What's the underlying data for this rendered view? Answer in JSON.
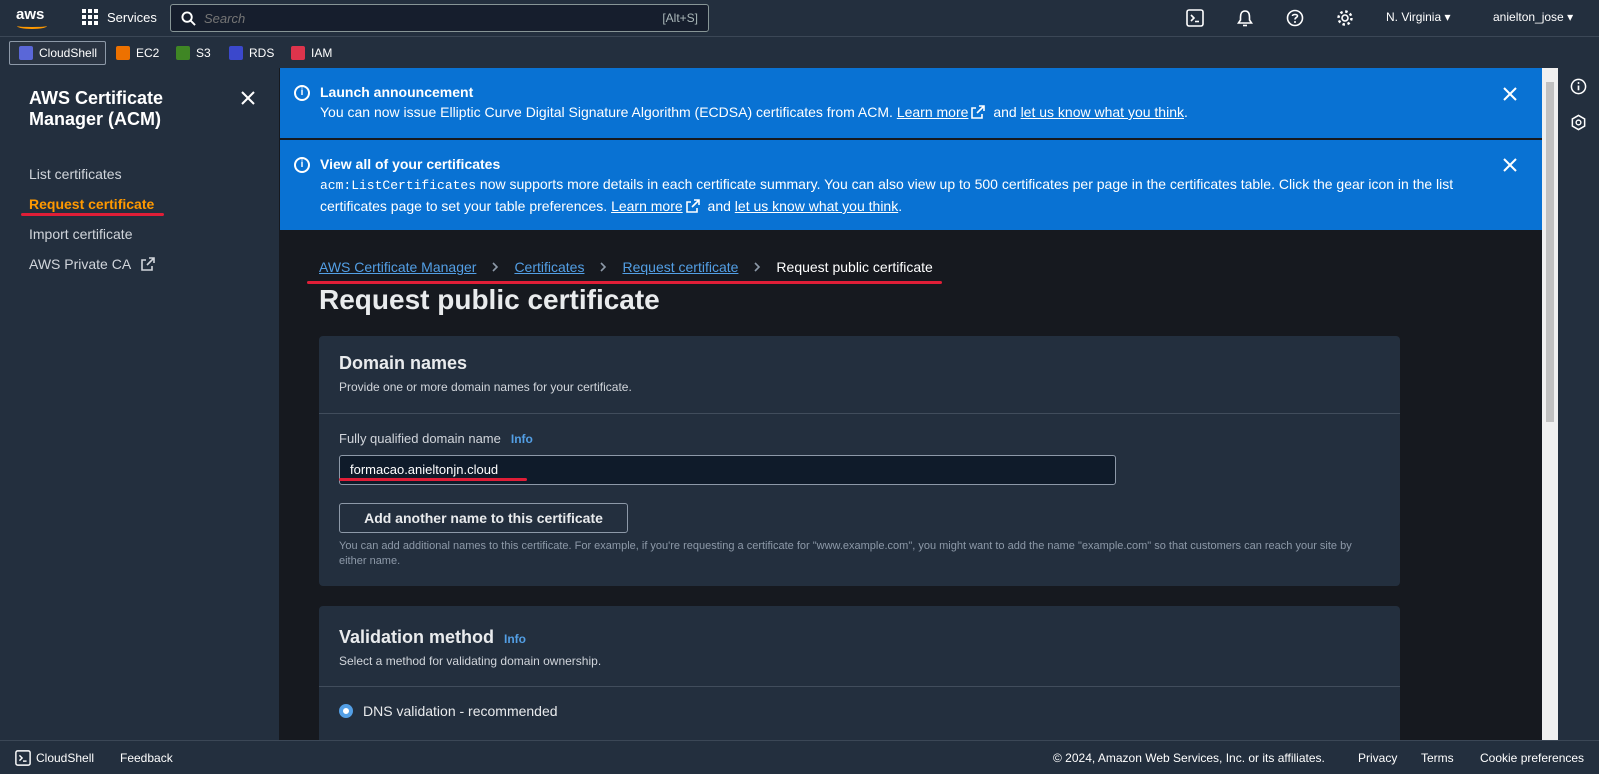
{
  "topbar": {
    "logo": "aws",
    "services_label": "Services",
    "search_placeholder": "Search",
    "search_shortcut": "[Alt+S]",
    "region": "N. Virginia",
    "user": "anielton_jose"
  },
  "shortcuts": [
    {
      "label": "CloudShell",
      "color": "#5a67d8"
    },
    {
      "label": "EC2",
      "color": "#ed7100"
    },
    {
      "label": "S3",
      "color": "#3f8624"
    },
    {
      "label": "RDS",
      "color": "#3b48cc"
    },
    {
      "label": "IAM",
      "color": "#dd344c"
    }
  ],
  "sidebar": {
    "title": "AWS Certificate Manager (ACM)",
    "items": [
      {
        "label": "List certificates"
      },
      {
        "label": "Request certificate"
      },
      {
        "label": "Import certificate"
      },
      {
        "label": "AWS Private CA"
      }
    ]
  },
  "flash1": {
    "title": "Launch announcement",
    "text": "You can now issue Elliptic Curve Digital Signature Algorithm (ECDSA) certificates from ACM.",
    "learn_more": "Learn more",
    "and": "and",
    "feedback": "let us know what you think",
    "end": "."
  },
  "flash2": {
    "title": "View all of your certificates",
    "code": "acm:ListCertificates",
    "text": "now supports more details in each certificate summary. You can also view up to 500 certificates per page in the certificates table. Click the gear icon in the list certificates page to set your table preferences.",
    "learn_more": "Learn more",
    "and": "and",
    "feedback": "let us know what you think",
    "end": "."
  },
  "breadcrumb": [
    "AWS Certificate Manager",
    "Certificates",
    "Request certificate",
    "Request public certificate"
  ],
  "page_title": "Request public certificate",
  "domain_card": {
    "title": "Domain names",
    "description": "Provide one or more domain names for your certificate.",
    "field_label": "Fully qualified domain name",
    "info": "Info",
    "field_value": "formacao.anieltonjn.cloud",
    "add_button": "Add another name to this certificate",
    "hint": "You can add additional names to this certificate. For example, if you're requesting a certificate for \"www.example.com\", you might want to add the name \"example.com\" so that customers can reach your site by either name."
  },
  "validation_card": {
    "title": "Validation method",
    "info": "Info",
    "description": "Select a method for validating domain ownership.",
    "option1": "DNS validation - recommended"
  },
  "footer": {
    "cloudshell": "CloudShell",
    "feedback": "Feedback",
    "copyright": "© 2024, Amazon Web Services, Inc. or its affiliates.",
    "privacy": "Privacy",
    "terms": "Terms",
    "cookies": "Cookie preferences"
  }
}
